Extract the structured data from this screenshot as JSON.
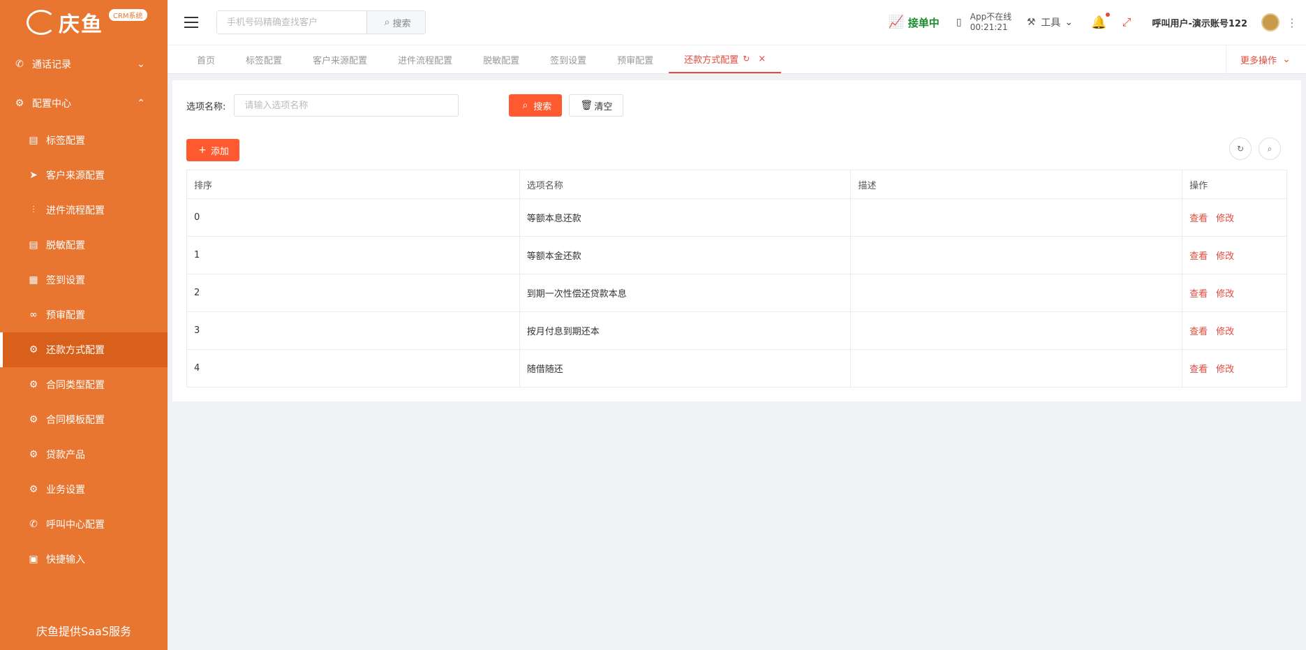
{
  "brand": {
    "name": "庆鱼",
    "badge": "CRM系统",
    "footer": "庆鱼提供SaaS服务"
  },
  "colors": {
    "sidebar": "#e87530",
    "sidebar_active": "#d9601a",
    "accent": "#e64a3c",
    "primary_button": "#ff5a2f",
    "online": "#1a8c2e"
  },
  "sidebar": {
    "groups": [
      {
        "label": "通话记录",
        "icon": "phone-icon",
        "expanded": false
      },
      {
        "label": "配置中心",
        "icon": "gear-icon",
        "expanded": true
      }
    ],
    "items": [
      {
        "label": "标签配置",
        "icon": "document-icon"
      },
      {
        "label": "客户来源配置",
        "icon": "send-icon"
      },
      {
        "label": "进件流程配置",
        "icon": "flow-icon"
      },
      {
        "label": "脱敏配置",
        "icon": "document-icon"
      },
      {
        "label": "签到设置",
        "icon": "calendar-icon"
      },
      {
        "label": "预审配置",
        "icon": "glasses-icon"
      },
      {
        "label": "还款方式配置",
        "icon": "gear-icon",
        "active": true
      },
      {
        "label": "合同类型配置",
        "icon": "gear-icon"
      },
      {
        "label": "合同模板配置",
        "icon": "gear-icon"
      },
      {
        "label": "贷款产品",
        "icon": "gear-icon"
      },
      {
        "label": "业务设置",
        "icon": "gear-icon"
      },
      {
        "label": "呼叫中心配置",
        "icon": "phone-icon"
      },
      {
        "label": "快捷输入",
        "icon": "edit-document-icon"
      }
    ]
  },
  "header": {
    "search_placeholder": "手机号码精确查找客户",
    "search_button": "搜索",
    "status": "接单中",
    "app_status_line1": "App不在线",
    "app_status_line2": "00:21:21",
    "tools": "工具",
    "username": "呼叫用户-演示账号122"
  },
  "tabs": {
    "items": [
      "首页",
      "标签配置",
      "客户来源配置",
      "进件流程配置",
      "脱敏配置",
      "签到设置",
      "预审配置",
      "还款方式配置"
    ],
    "active_index": 7,
    "more_ops": "更多操作"
  },
  "filter": {
    "label": "选项名称:",
    "placeholder": "请输入选项名称",
    "search_button": "搜索",
    "clear_button": "清空",
    "add_button": "添加"
  },
  "table": {
    "headers": [
      "排序",
      "选项名称",
      "描述",
      "操作"
    ],
    "rows": [
      {
        "order": "0",
        "name": "等额本息还款",
        "desc": ""
      },
      {
        "order": "1",
        "name": "等额本金还款",
        "desc": ""
      },
      {
        "order": "2",
        "name": "到期一次性偿还贷款本息",
        "desc": ""
      },
      {
        "order": "3",
        "name": "按月付息到期还本",
        "desc": ""
      },
      {
        "order": "4",
        "name": "随借随还",
        "desc": ""
      }
    ],
    "actions": {
      "view": "查看",
      "edit": "修改"
    }
  }
}
